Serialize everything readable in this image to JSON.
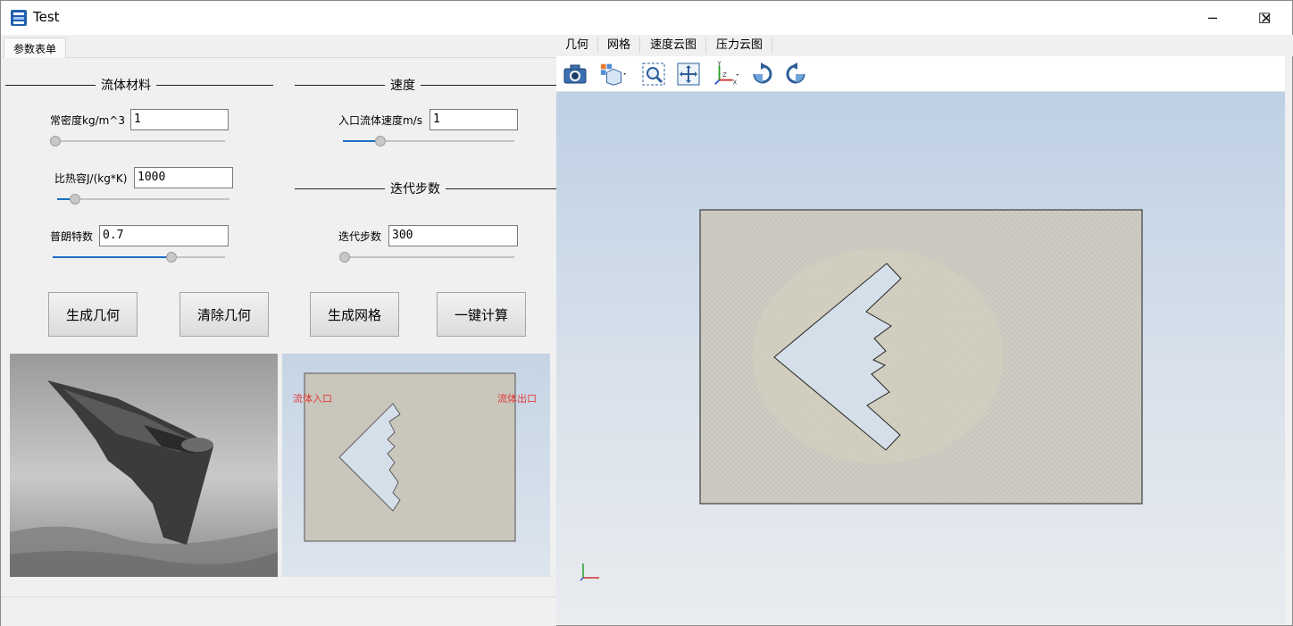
{
  "window": {
    "title": "Test",
    "controls": {
      "minimize": "─",
      "maximize": "☐",
      "close": "✕"
    }
  },
  "left_tab": {
    "label": "参数表单"
  },
  "groups": {
    "fluid_material": "流体材料",
    "velocity": "速度",
    "iteration": "迭代步数"
  },
  "fields": {
    "density": {
      "label": "常密度kg/m^3",
      "value": "1",
      "slider_fraction": 0.0
    },
    "specific_heat": {
      "label": "比热容J/(kg*K)",
      "value": "1000",
      "slider_fraction": 0.08
    },
    "prandtl": {
      "label": "普朗特数",
      "value": "0.7",
      "slider_fraction": 0.7
    },
    "inlet_velocity": {
      "label": "入口流体速度m/s",
      "value": "1",
      "slider_fraction": 0.2
    },
    "iteration_steps": {
      "label": "迭代步数",
      "value": "300",
      "slider_fraction": 0.0
    }
  },
  "buttons": {
    "generate_geometry": "生成几何",
    "clear_geometry": "清除几何",
    "generate_mesh": "生成网格",
    "one_click_compute": "一键计算"
  },
  "preview": {
    "inlet_label": "流体入口",
    "outlet_label": "流体出口"
  },
  "right_tabs": [
    "几何",
    "网格",
    "速度云图",
    "压力云图"
  ],
  "toolbar_icons": [
    "camera-icon",
    "view-cube-icon",
    "zoom-window-icon",
    "pan-fit-icon",
    "axis-icon",
    "rotate-cw-icon",
    "rotate-ccw-icon"
  ],
  "colors": {
    "slider_fill": "#1a6fc4",
    "label_red": "#e23a3a",
    "domain_fill": "#c9c6bc",
    "aircraft_fill": "#d5dfea"
  }
}
